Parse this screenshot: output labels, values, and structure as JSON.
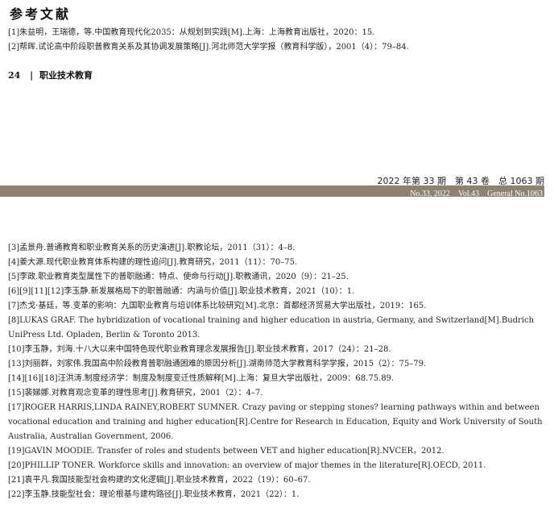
{
  "references_title": "参考文献",
  "top_refs": [
    "[1]朱益明，王瑞德，等.中国教育现代化2035：从规划到实践[M].上海：上海教育出版社，2020：15.",
    "[2]帮晖.试论高中阶段职普教育关系及其协调发展策略[J].河北师范大学学报（教育科学版），2001（4）：79–84."
  ],
  "footer": {
    "page_number": "24",
    "separator": "|",
    "journal_name": "职业技术教育"
  },
  "issue_header": {
    "chinese": "2022 年第 33 期　第 43 卷　总 1063 期",
    "english": "No.33, 2022　Vol.43　General No.1063"
  },
  "bottom_refs": [
    "[3]孟景舟.普通教育和职业教育关系的历史演进[J].职教论坛，2011（31）：4–8.",
    "[4]姜大源.现代职业教育体系构建的理性追问[J].教育研究，2011（11）：70–75.",
    "[5]李政.职业教育类型属性下的普职融通：特点、使命与行动[J].职教通讯，2020（9）：21–25.",
    "[6][9][11][12]李玉静.新发展格局下的职普融通：内涵与价值[J].职业技术教育，2021（10）：1.",
    "[7]杰戈·基廷，等.变革的影响：九国职业教育与培训体系比较研究[M].北京：首都经济贸易大学出版社，2019：165.",
    "[8]LUKAS GRAF. The hybridization of vocational training and higher education in austria, Germany, and Switzerland[M].Budrich UniPress Ltd. Opladen, Berlin & Toronto 2013.",
    "[10]李玉静，刘海.十八大以来中国特色现代职业教育理念发展报告[J].职业技术教育，2017（24）：21–28.",
    "[13]刘丽群，刘家伟.我国高中阶段教育普职融通困难的原因分析[J].湖南师范大学教育科学学报，2015（2）：75–79.",
    "[14][16][18]汪洪涛.制度经济学：制度及制度变迁性质解释[M].上海：复旦大学出版社，2009：68.75.89.",
    "[15]裴娣娜.对教育观念变革的理性思考[J].教育研究，2001（2）：4–7.",
    "[17]ROGER HARRIS,LINDA RAINEY,ROBERT SUMNER. Crazy paving or stepping stones? learning pathways within and between vocational education and training and higher education[R].Centre for Research in Education, Equity and Work University of South Australia, Australian Government, 2006.",
    "[19]GAVIN MOODIE. Transfer of roles and students between VET and higher education[R].NVCER，2012.",
    "[20]PHILLIP TONER. Workforce skills and innovation: an overview of major themes in the literature[R].OECD, 2011.",
    "[21]袁平凡.我国技能型社会构建的文化逻辑[J].职业技术教育，2022（19）：60–67.",
    "[22]李玉静.技能型社会：理论根基与建构路径[J].职业技术教育，2021（22）：1."
  ]
}
